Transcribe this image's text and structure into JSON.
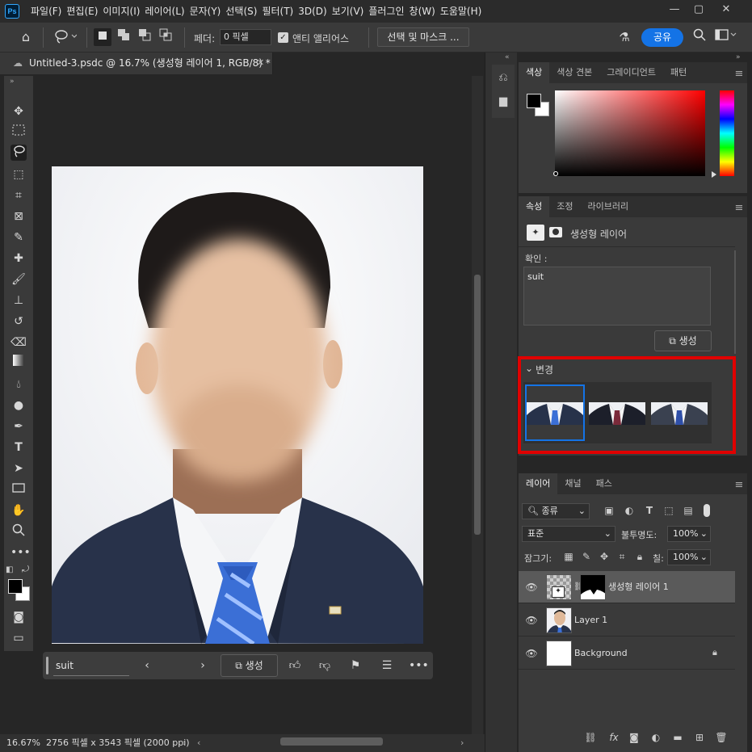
{
  "app": {
    "logo": "Ps"
  },
  "menu": [
    "파일(F)",
    "편집(E)",
    "이미지(I)",
    "레이어(L)",
    "문자(Y)",
    "선택(S)",
    "필터(T)",
    "3D(D)",
    "보기(V)",
    "플러그인",
    "창(W)",
    "도움말(H)"
  ],
  "options": {
    "feather_label": "페더:",
    "feather_value": "0 픽셀",
    "antialias_label": "앤티 앨리어스",
    "antialias_checked": true,
    "select_mask_label": "선택 및 마스크 ...",
    "share_label": "공유"
  },
  "document": {
    "tab_title": "Untitled-3.psdc @ 16.7% (생성형 레이어 1, RGB/8) *",
    "zoom": "16.67%",
    "dimensions": "2756 픽셀 x 3543 픽셀 (2000 ppi)"
  },
  "contextual_bar": {
    "prompt": "suit",
    "generate_label": "생성"
  },
  "color_panel": {
    "tabs": [
      "색상",
      "색상 견본",
      "그레이디언트",
      "패턴"
    ],
    "foreground": "#000000",
    "background": "#ffffff"
  },
  "properties_panel": {
    "tabs": [
      "속성",
      "조정",
      "라이브러리"
    ],
    "layer_type": "생성형 레이어",
    "prompt_label": "확인 :",
    "prompt_value": "suit",
    "generate_label": "생성",
    "variations_label": "변경",
    "selected_variation": 0,
    "variation_count": 3
  },
  "layers_panel": {
    "tabs": [
      "레이어",
      "채널",
      "패스"
    ],
    "filter_label": "종류",
    "blend_mode": "표준",
    "opacity_label": "불투명도:",
    "opacity_value": "100%",
    "lock_label": "잠그기:",
    "fill_label": "칠:",
    "fill_value": "100%",
    "layers": [
      {
        "name": "생성형 레이어 1",
        "selected": true
      },
      {
        "name": "Layer 1",
        "selected": false
      },
      {
        "name": "Background",
        "selected": false,
        "locked": true
      }
    ]
  },
  "colors": {
    "accent": "#1473e6",
    "highlight_box": "#e00000"
  }
}
